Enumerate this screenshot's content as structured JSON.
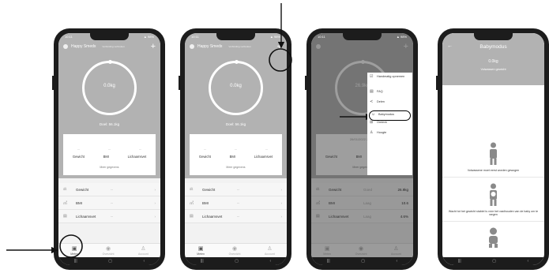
{
  "status": {
    "time": "10:11",
    "battery": "▲ 98%"
  },
  "app": {
    "username": "Happy Smeds",
    "connection": "Verbinding verbroken",
    "weight": "0.0kg",
    "goal": "Doel: 56.1kg",
    "metrics": [
      "Gewicht",
      "BMI",
      "Lichaamsvet"
    ],
    "placeholder": "--",
    "more": "Meer gegevens",
    "list": [
      {
        "icon": "⚖",
        "label": "Gewicht",
        "value": "--"
      },
      {
        "icon": "㎡",
        "label": "BMI",
        "value": "--"
      },
      {
        "icon": "▤",
        "label": "Lichaamsvet",
        "value": "--"
      }
    ],
    "tabs": [
      {
        "icon": "▣",
        "label": "Meten"
      },
      {
        "icon": "◉",
        "label": "Overzicht"
      },
      {
        "icon": "♙",
        "label": "Account"
      }
    ],
    "nav": [
      "|||",
      "▢",
      "‹"
    ]
  },
  "screen3": {
    "weight": "26.9kg",
    "date": "26/01/2022 20:22",
    "values": [
      "26.9kg",
      "10.6",
      "4.6%"
    ],
    "value_labels": [
      "Goed",
      "Laag",
      "Laag"
    ]
  },
  "menu": [
    {
      "icon": "☑",
      "label": "Handmatig opnemen"
    },
    {
      "icon": "▤",
      "label": "FAQ"
    },
    {
      "icon": "≺",
      "label": "Delen"
    },
    {
      "icon": "☺",
      "label": "Babymodus"
    },
    {
      "icon": "⊞",
      "label": "Omlevk"
    },
    {
      "icon": "♙",
      "label": "Hoogte"
    }
  ],
  "babymodus": {
    "back": "←",
    "title": "Babymodus",
    "weight": "0.0kg",
    "subtitle": "Volwassen gewicht",
    "step1": "Volwassene moet eerst worden gewogen",
    "step2": "Wacht tot het gewicht stabiel is vóór het vasthouden van de baby om te wegen"
  }
}
